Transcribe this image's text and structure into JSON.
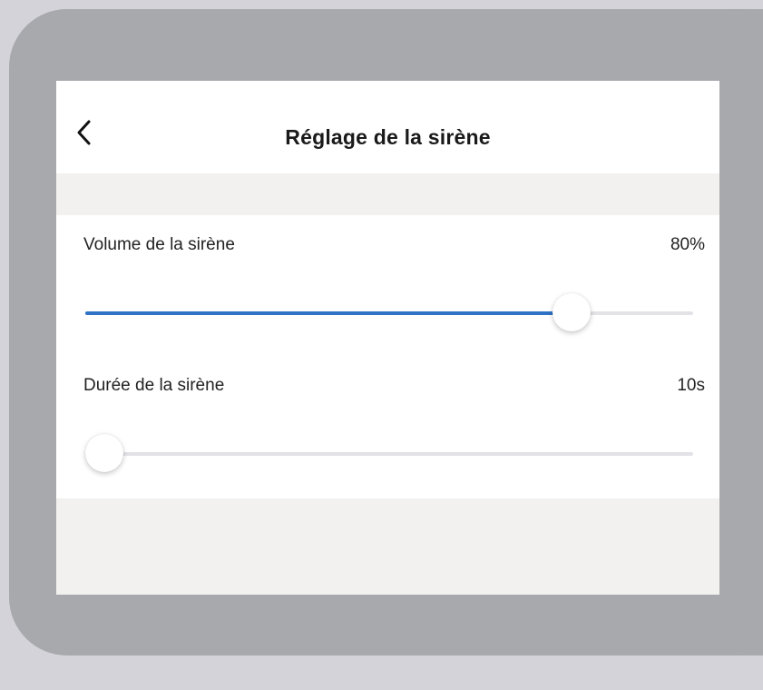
{
  "header": {
    "back_icon": "chevron-left-icon",
    "title": "Réglage de la sirène"
  },
  "settings": [
    {
      "label": "Volume de la sirène",
      "value": "80%",
      "slider_fraction": 0.8
    },
    {
      "label": "Durée de la sirène",
      "value": "10s",
      "slider_fraction": 0.0
    }
  ],
  "colors": {
    "accent": "#2f73c4",
    "frame": "#a7a9ac",
    "background": "#d4d3d9"
  }
}
